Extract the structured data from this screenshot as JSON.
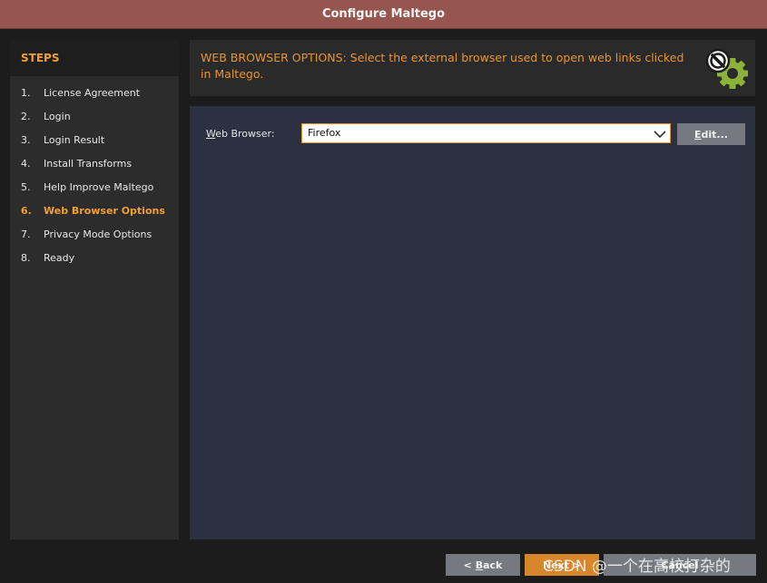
{
  "window": {
    "title": "Configure Maltego"
  },
  "steps": {
    "header": "STEPS",
    "items": [
      {
        "num": "1.",
        "label": "License Agreement"
      },
      {
        "num": "2.",
        "label": "Login"
      },
      {
        "num": "3.",
        "label": "Login Result"
      },
      {
        "num": "4.",
        "label": "Install Transforms"
      },
      {
        "num": "5.",
        "label": "Help Improve Maltego"
      },
      {
        "num": "6.",
        "label": "Web Browser Options",
        "active": true
      },
      {
        "num": "7.",
        "label": "Privacy Mode Options"
      },
      {
        "num": "8.",
        "label": "Ready"
      }
    ]
  },
  "banner": {
    "text": "WEB BROWSER OPTIONS: Select the external browser used to open web links clicked in Maltego.",
    "icon": "settings-gear-icon",
    "accent": "#e8952e"
  },
  "form": {
    "web_browser_label_mnemonic": "W",
    "web_browser_label_rest": "eb Browser:",
    "web_browser_value": "Firefox",
    "edit_mnemonic": "E",
    "edit_rest": "dit..."
  },
  "footer": {
    "back_prefix": "< ",
    "back_mnemonic": "B",
    "back_rest": "ack",
    "next_label": "Next >",
    "cancel_label": "Cancel"
  },
  "watermark": "CSDN @一个在高校打杂的",
  "colors": {
    "titlebar": "#96564f",
    "active_step": "#f0a030",
    "next_button": "#d7862a",
    "gear_green": "#8bb33a"
  }
}
